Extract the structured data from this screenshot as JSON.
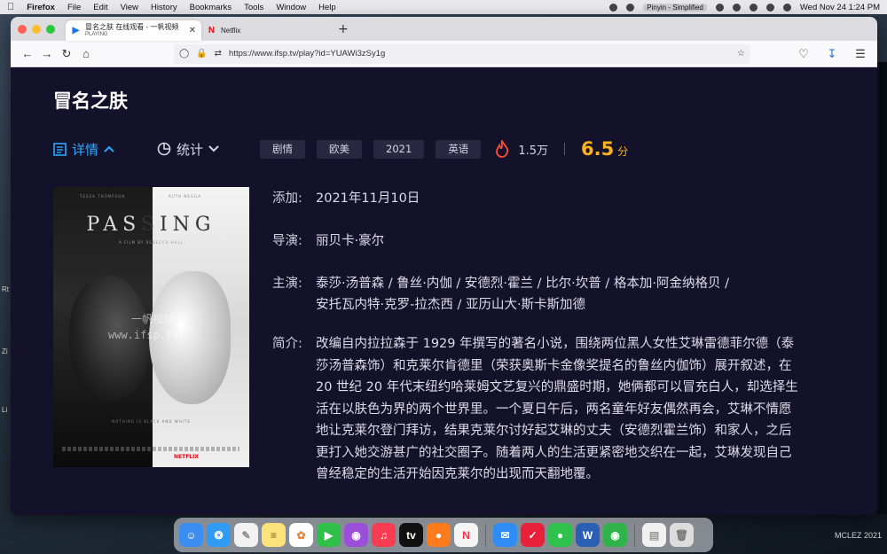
{
  "menubar": {
    "app": "Firefox",
    "items": [
      "File",
      "Edit",
      "View",
      "History",
      "Bookmarks",
      "Tools",
      "Window",
      "Help"
    ],
    "input_method": "Pinyin - Simplified",
    "datetime": "Wed Nov 24  1:24 PM"
  },
  "tabs": [
    {
      "title": "冒名之肤 在线观看 - 一帆视频",
      "subtitle": "PLAYING",
      "favicon": "play-icon"
    },
    {
      "title": "Netflix",
      "favicon": "netflix-icon"
    }
  ],
  "navbar": {
    "url": "https://www.ifsp.tv/play?id=YUAWi3zSy1g"
  },
  "page": {
    "title": "冒名之肤",
    "detail_label": "详情",
    "stats_label": "统计",
    "tags": [
      "剧情",
      "欧美",
      "2021",
      "英语"
    ],
    "heat": "1.5万",
    "score": "6.5",
    "score_unit": "分"
  },
  "poster": {
    "title_left": "PAS",
    "title_right": "SING",
    "cast_left": "TESSA THOMPSON",
    "cast_right": "RUTH NEGGA",
    "byline": "A FILM BY REBECCA HALL",
    "watermark_cn": "一帆视频",
    "watermark_url": "www.ifsp.tv",
    "tagline": "NOTHING IS BLACK AND WHITE",
    "brand": "NETFLIX"
  },
  "info": {
    "added_label": "添加:",
    "added": "2021年11月10日",
    "director_label": "导演:",
    "director": "丽贝卡·豪尔",
    "cast_label": "主演:",
    "cast_line1": "泰莎·汤普森 / 鲁丝·内伽 / 安德烈·霍兰 / 比尔·坎普 / 格本加·阿金纳格贝 /",
    "cast_line2": "安托瓦内特·克罗-拉杰西 / 亚历山大·斯卡斯加德",
    "synopsis_label": "简介:",
    "synopsis_lines": [
      "改编自内拉拉森于 1929 年撰写的著名小说，围绕两位黑人女性艾琳雷德菲尔德（泰",
      "莎汤普森饰）和克莱尔肯德里（荣获奥斯卡金像奖提名的鲁丝内伽饰）展开叙述，在",
      "20 世纪 20 年代末纽约哈莱姆文艺复兴的鼎盛时期，她俩都可以冒充白人，却选择生",
      "活在以肤色为界的两个世界里。一个夏日午后，两名童年好友偶然再会，艾琳不情愿",
      "地让克莱尔登门拜访，结果克莱尔讨好起艾琳的丈夫（安德烈霍兰饰）和家人，之后",
      "更打入她交游甚广的社交圈子。随着两人的生活更紧密地交织在一起，艾琳发现自己",
      "曾经稳定的生活开始因克莱尔的出现而天翻地覆。"
    ]
  },
  "desktop": {
    "footer": "MCLEZ 2021",
    "side_labels": [
      "Rt",
      "Zi",
      "Li"
    ]
  },
  "dock": {
    "apps": [
      "finder",
      "safari",
      "textedit",
      "notes",
      "photos",
      "facetime",
      "podcasts",
      "music",
      "appletv",
      "firefox",
      "news",
      "mail",
      "tasks",
      "messages",
      "word",
      "wechat",
      "document",
      "trash"
    ]
  },
  "colors": {
    "accent": "#2ea8ff",
    "score": "#ffb21e",
    "page_bg": "#14112a",
    "tag_bg": "#2a2742",
    "heat": "#ff4d3a"
  }
}
